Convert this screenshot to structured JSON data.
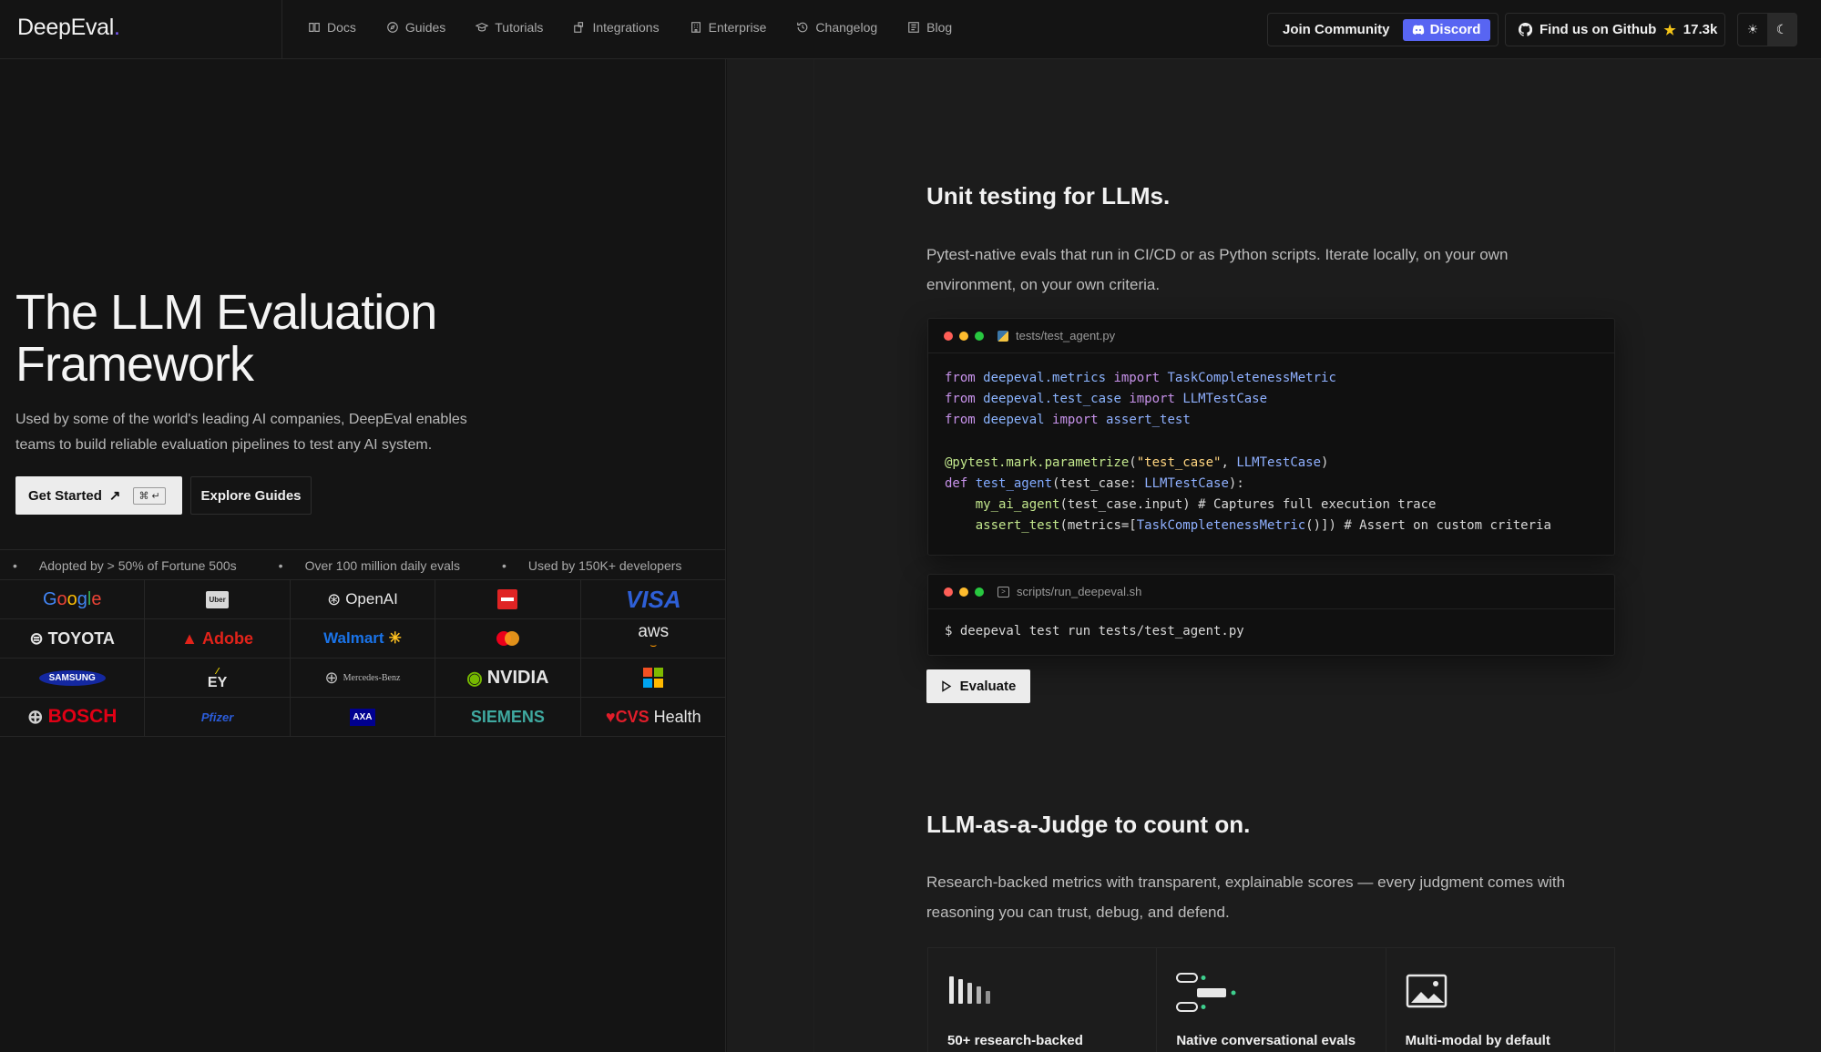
{
  "nav": {
    "logo": "DeepEval",
    "logo_dot": ".",
    "links": [
      {
        "label": "Docs",
        "icon": "book-icon"
      },
      {
        "label": "Guides",
        "icon": "compass-icon"
      },
      {
        "label": "Tutorials",
        "icon": "graduation-cap-icon"
      },
      {
        "label": "Integrations",
        "icon": "puzzle-icon"
      },
      {
        "label": "Enterprise",
        "icon": "building-icon"
      },
      {
        "label": "Changelog",
        "icon": "history-icon"
      },
      {
        "label": "Blog",
        "icon": "newspaper-icon"
      }
    ],
    "join_community": "Join Community",
    "discord": "Discord",
    "github": "Find us on Github",
    "github_stars": "17.3k",
    "theme_light_icon": "☀",
    "theme_dark_icon": "☾"
  },
  "hero": {
    "title": "The LLM Evaluation Framework",
    "subtitle": "Used by some of the world's leading AI companies, DeepEval enables teams to build reliable evaluation pipelines to test any AI system.",
    "get_started": "Get Started",
    "get_started_arrow": "↗",
    "shortcut": "⌘ ↵",
    "explore_guides": "Explore Guides"
  },
  "ticker": [
    "Adopted by > 50% of Fortune 500s",
    "Over 100 million daily evals",
    "Used by 150K+ developers"
  ],
  "logos": [
    "Google",
    "Uber",
    "OpenAI",
    "Red",
    "VISA",
    "TOYOTA",
    "Adobe",
    "Walmart",
    "mastercard",
    "aws",
    "SAMSUNG",
    "EY",
    "Mercedes-Benz",
    "NVIDIA",
    "Microsoft",
    "BOSCH",
    "Pfizer",
    "AXA",
    "SIEMENS",
    "CVSHealth"
  ],
  "section1": {
    "title": "Unit testing for LLMs.",
    "subtitle": "Pytest-native evals that run in CI/CD or as Python scripts. Iterate locally, on your own environment, on your own criteria.",
    "code_filename": "tests/test_agent.py",
    "shell_filename": "scripts/run_deepeval.sh",
    "shell_command": "$ deepeval test run tests/test_agent.py",
    "evaluate": "Evaluate"
  },
  "section2": {
    "title": "LLM-as-a-Judge to count on.",
    "subtitle": "Research-backed metrics with transparent, explainable scores — every judgment comes with reasoning you can trust, debug, and defend.",
    "cards": [
      {
        "label": "50+ research-backed",
        "icon": "bar-metrics-icon"
      },
      {
        "label": "Native conversational evals",
        "icon": "conversation-icon"
      },
      {
        "label": "Multi-modal by default",
        "icon": "image-icon"
      }
    ]
  },
  "colors": {
    "accent": "#7c5cff",
    "discord": "#5865f2",
    "background": "#141414",
    "panel": "#1c1c1c"
  }
}
